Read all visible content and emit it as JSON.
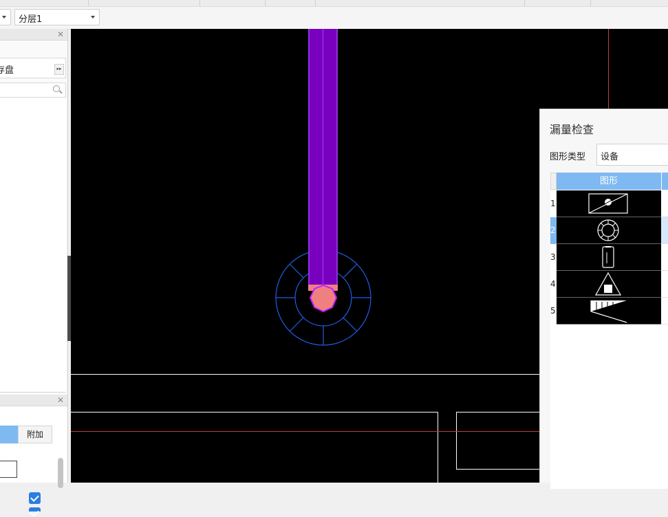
{
  "toolbar": {
    "dropdown1": {
      "value": ""
    },
    "dropdown2": {
      "value": "分层1"
    }
  },
  "left_panel": {
    "tab_label": "存盘",
    "lower_column_header": "附加",
    "checkboxes": [
      true,
      true
    ]
  },
  "dialog": {
    "title": "漏量检查",
    "type_label": "图形类型",
    "type_value": "设备",
    "grid": {
      "header": "图形",
      "rows": [
        {
          "index": "1",
          "icon": "diagonal-box-symbol-icon",
          "selected": false
        },
        {
          "index": "2",
          "icon": "octagon-ring-symbol-icon",
          "selected": true
        },
        {
          "index": "3",
          "icon": "rectangle-device-symbol-icon",
          "selected": false
        },
        {
          "index": "4",
          "icon": "triangle-square-symbol-icon",
          "selected": false
        },
        {
          "index": "5",
          "icon": "hatched-wedge-symbol-icon",
          "selected": false
        }
      ]
    }
  },
  "colors": {
    "canvas_bg": "#000000",
    "pipe": "#7a00c0",
    "outer_ring": "#1e5fe6",
    "fitting": "#f08080",
    "fitting_outline": "#c020ff",
    "red_line": "#c04040",
    "selection": "#7fb9f2"
  }
}
